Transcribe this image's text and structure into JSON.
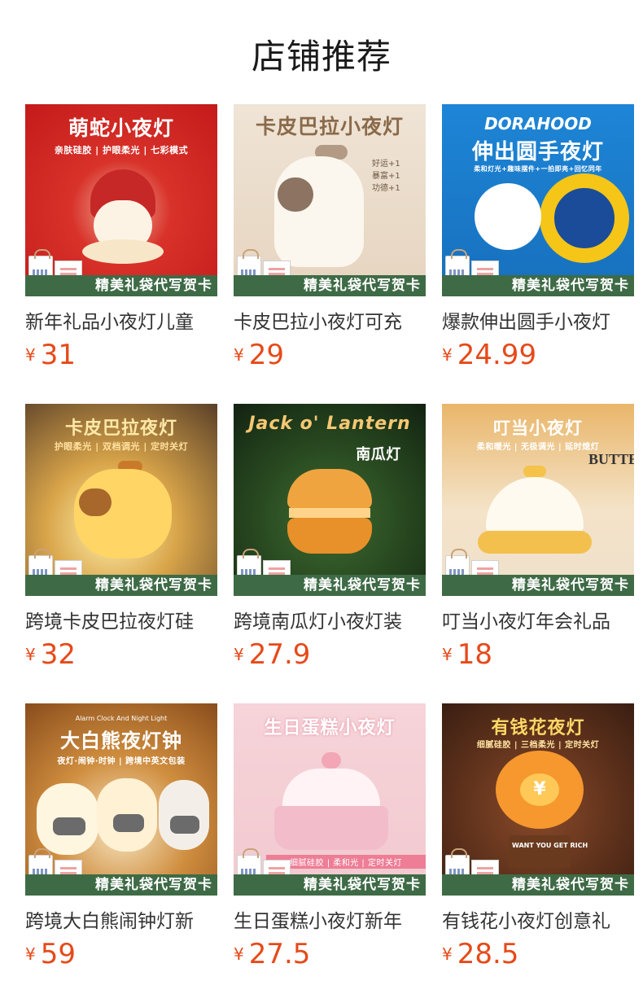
{
  "page": {
    "title": "店铺推荐"
  },
  "banner_text": "精美礼袋代写贺卡",
  "currency": "¥",
  "products": [
    {
      "name": "新年礼品小夜灯儿童",
      "price": "31",
      "thumb": {
        "title": "萌蛇小夜灯",
        "subtitle": "亲肤硅胶 | 护眼柔光 | 七彩模式",
        "extra": ""
      }
    },
    {
      "name": "卡皮巴拉小夜灯可充",
      "price": "29",
      "thumb": {
        "title": "卡皮巴拉小夜灯",
        "subtitle": "",
        "extra": "好运+1 暴富+1 功德+1"
      }
    },
    {
      "name": "爆款伸出圆手小夜灯",
      "price": "24.99",
      "thumb": {
        "title": "伸出圆手夜灯",
        "subtitle": "柔和灯光+趣味摆件+一拍即亮+回忆同年",
        "extra": "DORAHOOD"
      }
    },
    {
      "name": "跨境卡皮巴拉夜灯硅",
      "price": "32",
      "thumb": {
        "title": "卡皮巴拉夜灯",
        "subtitle": "护眼柔光 | 双档调光 | 定时关灯",
        "extra": ""
      }
    },
    {
      "name": "跨境南瓜灯小夜灯装",
      "price": "27.9",
      "thumb": {
        "title": "Jack o' Lantern",
        "subtitle": "南瓜灯",
        "extra": ""
      }
    },
    {
      "name": "叮当小夜灯年会礼品",
      "price": "18",
      "thumb": {
        "title": "叮当小夜灯",
        "subtitle": "柔和暖光 | 无极调光 | 延时熄灯",
        "extra": "BUTTER"
      }
    },
    {
      "name": "跨境大白熊闹钟灯新",
      "price": "59",
      "thumb": {
        "title": "大白熊夜灯钟",
        "subtitle": "夜灯·闹钟·时钟 | 跨境中英文包装",
        "extra": "Alarm Clock And Night Light"
      }
    },
    {
      "name": "生日蛋糕小夜灯新年",
      "price": "27.5",
      "thumb": {
        "title": "生日蛋糕小夜灯",
        "subtitle": "细腻硅胶 | 柔和光 | 定时关灯",
        "extra": ""
      }
    },
    {
      "name": "有钱花小夜灯创意礼",
      "price": "28.5",
      "thumb": {
        "title": "有钱花夜灯",
        "subtitle": "细腻硅胶 | 三档柔光 | 定时关灯",
        "extra": "WANT YOU GET RICH"
      }
    }
  ],
  "colors": {
    "price": "#e64a19",
    "banner_bg": "#3e6b46",
    "title_text": "#1a1a1a"
  }
}
